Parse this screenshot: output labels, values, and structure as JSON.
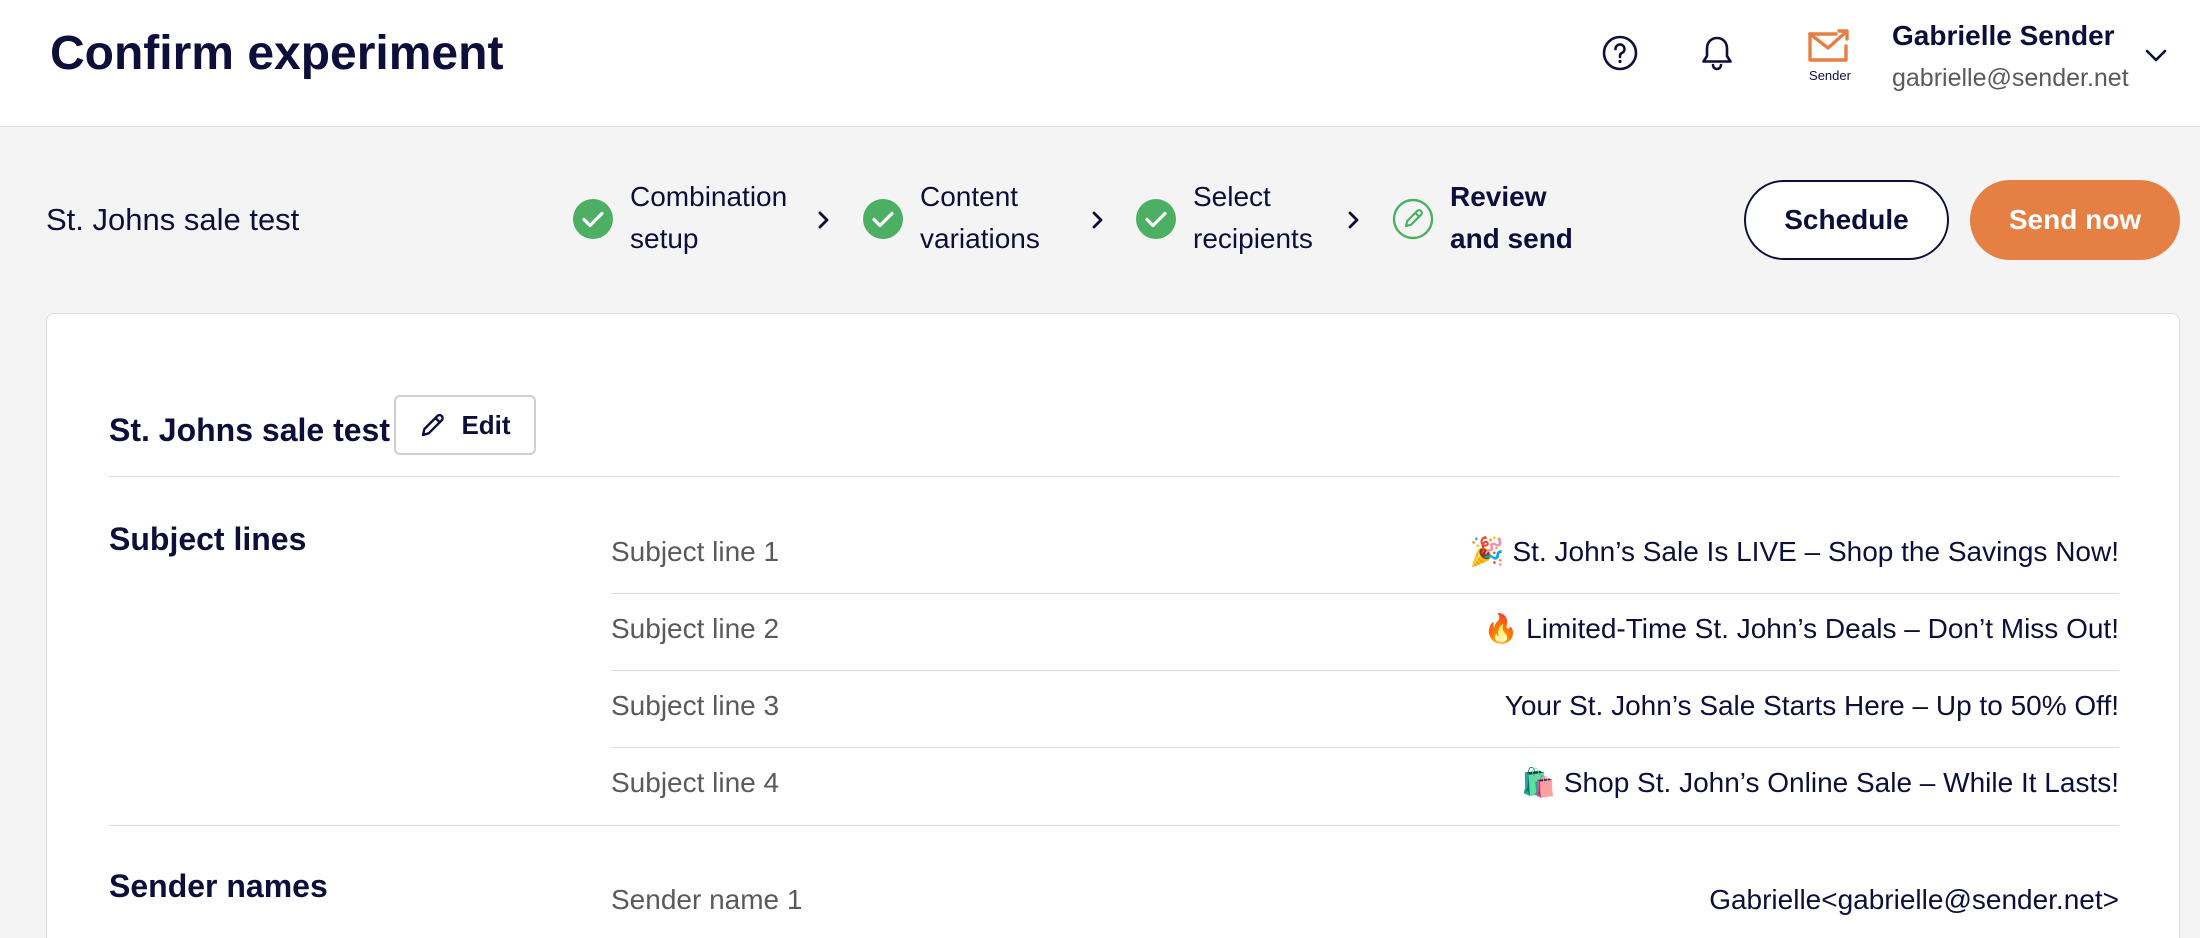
{
  "header": {
    "title": "Confirm experiment",
    "user": {
      "name": "Gabrielle Sender",
      "email": "gabrielle@sender.net"
    },
    "brand_logo_text": "Sender"
  },
  "experiment": {
    "name": "St. Johns sale test"
  },
  "steps": [
    {
      "line1": "Combination",
      "line2": "setup",
      "state": "done"
    },
    {
      "line1": "Content",
      "line2": "variations",
      "state": "done"
    },
    {
      "line1": "Select",
      "line2": "recipients",
      "state": "done"
    },
    {
      "line1": "Review",
      "line2": "and send",
      "state": "current"
    }
  ],
  "actions": {
    "schedule_label": "Schedule",
    "send_label": "Send now"
  },
  "summary": {
    "title": "St. Johns sale test",
    "edit_label": "Edit",
    "subject_lines": {
      "title": "Subject lines",
      "rows": [
        {
          "label": "Subject line 1",
          "value": "🎉 St. John’s Sale Is LIVE – Shop the Savings Now!"
        },
        {
          "label": "Subject line 2",
          "value": "🔥 Limited-Time St. John’s Deals – Don’t Miss Out!"
        },
        {
          "label": "Subject line 3",
          "value": "Your St. John’s Sale Starts Here – Up to 50% Off!"
        },
        {
          "label": "Subject line 4",
          "value": "🛍️ Shop St. John’s Online Sale – While It Lasts!"
        }
      ]
    },
    "sender_names": {
      "title": "Sender names",
      "rows": [
        {
          "label": "Sender name 1",
          "value": "Gabrielle<gabrielle@sender.net>"
        }
      ]
    }
  },
  "colors": {
    "navy": "#0d0f3a",
    "accent_orange": "#e57f44",
    "step_done_green": "#4caf63",
    "divider": "#dcdcdc",
    "background": "#f4f4f4"
  },
  "icons": {
    "help": "help-circle-icon",
    "notifications": "bell-icon",
    "dropdown": "chevron-down-icon",
    "step_done": "check-circle-icon",
    "step_current": "pencil-circle-icon",
    "step_separator": "chevron-right-icon",
    "edit": "pencil-icon"
  }
}
